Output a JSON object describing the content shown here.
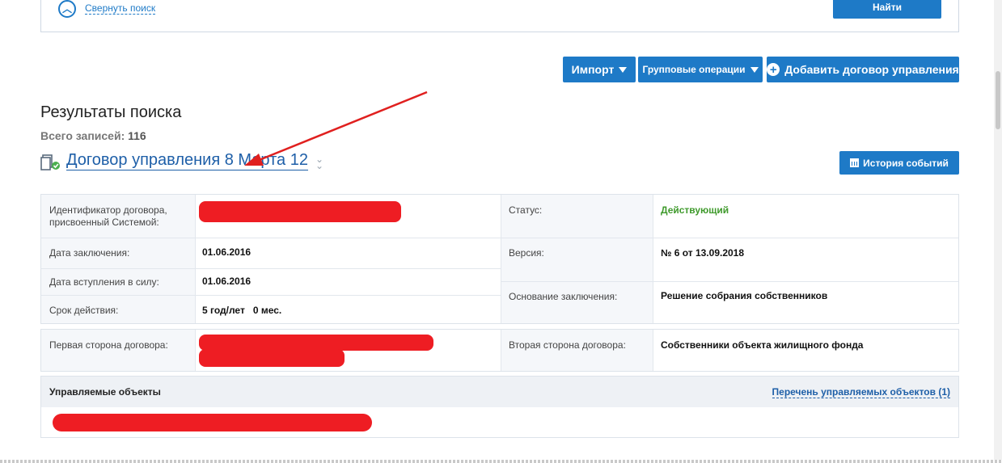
{
  "search": {
    "collapse_label": "Свернуть поиск",
    "find_label": "Найти"
  },
  "toolbar": {
    "import_label": "Импорт",
    "group_ops_label": "Групповые операции",
    "add_contract_label": "Добавить договор управления"
  },
  "results": {
    "title": "Результаты поиска",
    "total_label": "Всего записей:",
    "total_count": "116"
  },
  "contract": {
    "title": "Договор управления 8 Марта 12",
    "history_label": "История событий",
    "fields": {
      "id_label": "Идентификатор договора, присвоенный Системой:",
      "status_label": "Статус:",
      "status_value": "Действующий",
      "date_label": "Дата заключения:",
      "date_value": "01.06.2016",
      "version_label": "Версия:",
      "version_value": "№ 6 от 13.09.2018",
      "effective_label": "Дата вступления в силу:",
      "effective_value": "01.06.2016",
      "basis_label": "Основание заключения:",
      "basis_value": "Решение собрания собственников",
      "term_label": "Срок действия:",
      "term_value": "5 год/лет   0 мес.",
      "first_party_label": "Первая сторона договора:",
      "second_party_label": "Вторая сторона договора:",
      "second_party_value": "Собственники объекта жилищного фонда"
    },
    "objects": {
      "title": "Управляемые объекты",
      "list_link": "Перечень управляемых объектов (1)"
    }
  },
  "colors": {
    "primary": "#1e7ac7",
    "link": "#1e5fa8",
    "status_green": "#3f9a2c",
    "annotation_red": "#e0201f"
  }
}
